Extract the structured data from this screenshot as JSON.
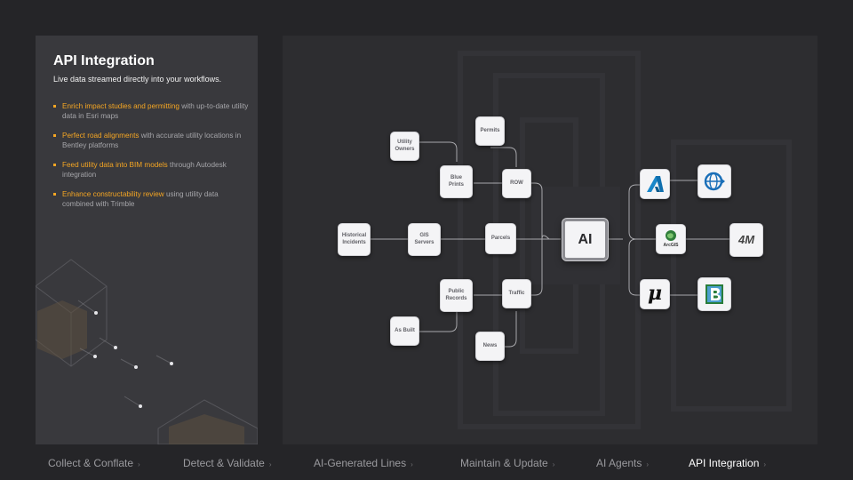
{
  "panel": {
    "title": "API Integration",
    "subtitle": "Live data streamed directly into your workflows.",
    "bullets": [
      {
        "highlight": "Enrich impact studies and permitting",
        "rest": " with up-to-date utility data in Esri maps"
      },
      {
        "highlight": "Perfect road alignments",
        "rest": " with accurate utility locations in Bentley platforms"
      },
      {
        "highlight": "Feed utility data into BIM models",
        "rest": " through Autodesk integration"
      },
      {
        "highlight": "Enhance constructability review",
        "rest": " using utility data combined with Trimble"
      }
    ]
  },
  "nodes": {
    "utility_owners": "Utility Owners",
    "permits": "Permits",
    "blue_prints": "Blue Prints",
    "row": "ROW",
    "historical_incidents": "Historical Incidents",
    "gis_servers": "GIS Servers",
    "parcels": "Parcels",
    "public_records": "Public Records",
    "traffic": "Traffic",
    "as_built": "As Built",
    "news": "News",
    "ai": "AI",
    "arcgis": "ArcGIS",
    "four_m": "4M",
    "mu": "μ"
  },
  "colors": {
    "accent": "#f5a623"
  },
  "nav": {
    "items": [
      {
        "label": "Collect & Conflate",
        "active": false
      },
      {
        "label": "Detect & Validate",
        "active": false
      },
      {
        "label": "AI-Generated Lines",
        "active": false
      },
      {
        "label": "Maintain & Update",
        "active": false
      },
      {
        "label": "AI Agents",
        "active": false
      },
      {
        "label": "API Integration",
        "active": true
      }
    ],
    "chevron": "›"
  }
}
